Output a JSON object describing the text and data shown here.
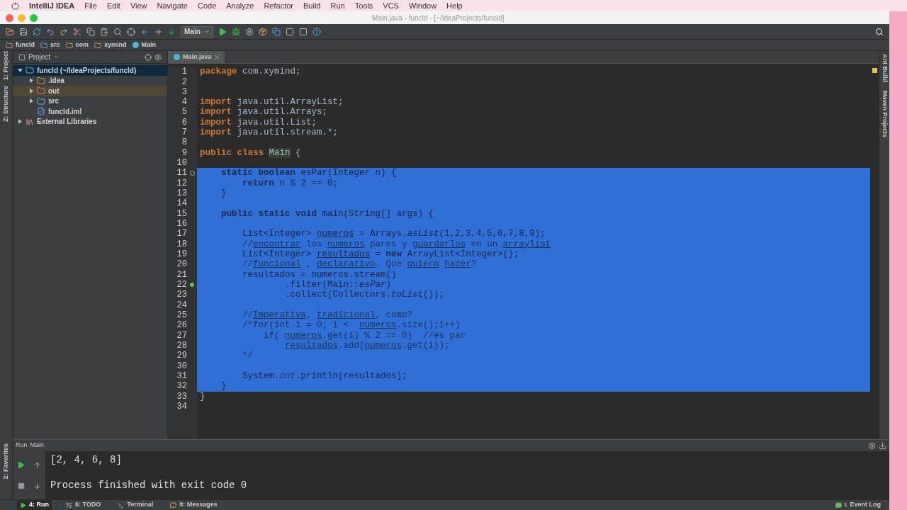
{
  "menu_bar": {
    "app": "IntelliJ IDEA",
    "items": [
      "File",
      "Edit",
      "View",
      "Navigate",
      "Code",
      "Analyze",
      "Refactor",
      "Build",
      "Run",
      "Tools",
      "VCS",
      "Window",
      "Help"
    ]
  },
  "window": {
    "title": "Main.java - funcld - [~/IdeaProjects/funcld]"
  },
  "toolbar": {
    "run_config": "Main"
  },
  "breadcrumbs": [
    {
      "label": "funcld",
      "kind": "folder"
    },
    {
      "label": "src",
      "kind": "source"
    },
    {
      "label": "com",
      "kind": "package"
    },
    {
      "label": "xymind",
      "kind": "package"
    },
    {
      "label": "Main",
      "kind": "class"
    }
  ],
  "left_stripe": [
    "1: Project",
    "Z: Structure",
    "2: Favorites"
  ],
  "right_stripe": [
    "Ant Build",
    "Maven Projects"
  ],
  "project_panel": {
    "title": "Project",
    "tree": [
      {
        "label": "funcld (~/IdeaProjects/funcld)",
        "kind": "module",
        "expanded": true,
        "selected": true,
        "children": [
          {
            "label": ".idea",
            "kind": "folder",
            "expanded": false,
            "selected": false
          },
          {
            "label": "out",
            "kind": "excluded",
            "expanded": false,
            "selected": false,
            "highlighted": true
          },
          {
            "label": "src",
            "kind": "source",
            "expanded": false,
            "selected": false
          },
          {
            "label": "funcld.iml",
            "kind": "file",
            "selected": false
          }
        ]
      },
      {
        "label": "External Libraries",
        "kind": "library",
        "expanded": false,
        "selected": false
      }
    ]
  },
  "editor": {
    "tabs": [
      {
        "label": "Main.java",
        "selected": true
      }
    ],
    "lines": [
      {
        "n": "1",
        "selected": false,
        "tokens": [
          {
            "kind": "kw",
            "t": "package"
          },
          {
            "kind": "txt",
            "t": " com.xymind;"
          }
        ]
      },
      {
        "n": "2",
        "selected": false
      },
      {
        "n": "3",
        "selected": false
      },
      {
        "n": "4",
        "selected": false,
        "tokens": [
          {
            "kind": "kw",
            "t": "import"
          },
          {
            "kind": "txt",
            "t": " java.util.ArrayList;"
          }
        ]
      },
      {
        "n": "5",
        "selected": false,
        "tokens": [
          {
            "kind": "kw",
            "t": "import"
          },
          {
            "kind": "txt",
            "t": " java.util.Arrays;"
          }
        ]
      },
      {
        "n": "6",
        "selected": false,
        "tokens": [
          {
            "kind": "kw",
            "t": "import"
          },
          {
            "kind": "txt",
            "t": " java.util.List;"
          }
        ]
      },
      {
        "n": "7",
        "selected": false,
        "tokens": [
          {
            "kind": "kw",
            "t": "import"
          },
          {
            "kind": "txt",
            "t": " java.util.stream.*;"
          }
        ]
      },
      {
        "n": "8",
        "selected": false
      },
      {
        "n": "9",
        "selected": false,
        "tokens": [
          {
            "kind": "kw",
            "t": "public class "
          },
          {
            "kind": "hl",
            "t": "Main"
          },
          {
            "kind": "txt",
            "t": " {"
          }
        ]
      },
      {
        "n": "10",
        "selected": false
      },
      {
        "n": "11",
        "selected": true,
        "marker": {
          "kind": "override"
        },
        "tokens": [
          {
            "kind": "kw",
            "t": "    static boolean "
          },
          {
            "kind": "fn",
            "t": "esPar"
          },
          {
            "kind": "txt",
            "t": "(Integer n) {"
          }
        ]
      },
      {
        "n": "12",
        "selected": true,
        "tokens": [
          {
            "kind": "kw",
            "t": "        return"
          },
          {
            "kind": "txt",
            "t": " n % "
          },
          {
            "kind": "num",
            "t": "2"
          },
          {
            "kind": "txt",
            "t": " == "
          },
          {
            "kind": "num",
            "t": "0"
          },
          {
            "kind": "txt",
            "t": ";"
          }
        ]
      },
      {
        "n": "13",
        "selected": true,
        "tokens": [
          {
            "kind": "txt",
            "t": "    }"
          }
        ]
      },
      {
        "n": "14",
        "selected": true
      },
      {
        "n": "15",
        "selected": true,
        "tokens": [
          {
            "kind": "kw",
            "t": "    public static void "
          },
          {
            "kind": "fn",
            "t": "main"
          },
          {
            "kind": "txt",
            "t": "(String[] args) {"
          }
        ]
      },
      {
        "n": "16",
        "selected": true
      },
      {
        "n": "17",
        "selected": true,
        "tokens": [
          {
            "kind": "txt",
            "t": "        List<Integer> "
          },
          {
            "kind": "typo",
            "t": "numeros"
          },
          {
            "kind": "txt",
            "t": " = Arrays."
          },
          {
            "kind": "italic",
            "t": "asList"
          },
          {
            "kind": "txt",
            "t": "(1,2,3,4,5,6,7,8,9);"
          }
        ]
      },
      {
        "n": "18",
        "selected": true,
        "tokens": [
          {
            "kind": "cmt",
            "t": "        //"
          },
          {
            "kind": "ctypo",
            "t": "encontrar"
          },
          {
            "kind": "cmt",
            "t": " los "
          },
          {
            "kind": "ctypo",
            "t": "numeros"
          },
          {
            "kind": "cmt",
            "t": " pares y "
          },
          {
            "kind": "ctypo",
            "t": "guardarlos"
          },
          {
            "kind": "cmt",
            "t": " en un "
          },
          {
            "kind": "ctypo",
            "t": "arraylist"
          }
        ]
      },
      {
        "n": "19",
        "selected": true,
        "tokens": [
          {
            "kind": "txt",
            "t": "        List<Integer> "
          },
          {
            "kind": "typo",
            "t": "resultados"
          },
          {
            "kind": "txt",
            "t": " = "
          },
          {
            "kind": "kw",
            "t": "new"
          },
          {
            "kind": "txt",
            "t": " ArrayList<Integer>();"
          }
        ]
      },
      {
        "n": "20",
        "selected": true,
        "tokens": [
          {
            "kind": "cmt",
            "t": "        //"
          },
          {
            "kind": "ctypo",
            "t": "funcional"
          },
          {
            "kind": "cmt",
            "t": " , "
          },
          {
            "kind": "ctypo",
            "t": "declarativo"
          },
          {
            "kind": "cmt",
            "t": ". Que "
          },
          {
            "kind": "ctypo",
            "t": "quiero"
          },
          {
            "kind": "ctypo",
            "t": " hacer"
          },
          {
            "kind": "cmt",
            "t": "?"
          }
        ]
      },
      {
        "n": "21",
        "selected": true,
        "tokens": [
          {
            "kind": "txt",
            "t": "        resultados = numeros.stream()"
          }
        ]
      },
      {
        "n": "22",
        "selected": true,
        "marker": {
          "kind": "lambda"
        },
        "tokens": [
          {
            "kind": "txt",
            "t": "                .filter(Main::"
          },
          {
            "kind": "italic",
            "t": "esPar"
          },
          {
            "kind": "txt",
            "t": ")"
          }
        ]
      },
      {
        "n": "23",
        "selected": true,
        "tokens": [
          {
            "kind": "txt",
            "t": "                .collect(Collectors."
          },
          {
            "kind": "italic",
            "t": "toList"
          },
          {
            "kind": "txt",
            "t": "());"
          }
        ]
      },
      {
        "n": "24",
        "selected": true
      },
      {
        "n": "25",
        "selected": true,
        "tokens": [
          {
            "kind": "cmt",
            "t": "        //"
          },
          {
            "kind": "ctypo",
            "t": "Imperativa"
          },
          {
            "kind": "cmt",
            "t": ", "
          },
          {
            "kind": "ctypo",
            "t": "tradicional"
          },
          {
            "kind": "cmt",
            "t": ", como?"
          }
        ]
      },
      {
        "n": "26",
        "selected": true,
        "tokens": [
          {
            "kind": "cmt",
            "t": "        /*for(int i = 0; i <  "
          },
          {
            "kind": "ctypo",
            "t": "numeros"
          },
          {
            "kind": "cmt",
            "t": ".size();i++)"
          }
        ]
      },
      {
        "n": "27",
        "selected": true,
        "tokens": [
          {
            "kind": "cmt",
            "t": "            if( "
          },
          {
            "kind": "ctypo",
            "t": "numeros"
          },
          {
            "kind": "cmt",
            "t": ".get(i) % 2 == 0)  //es par"
          }
        ]
      },
      {
        "n": "28",
        "selected": true,
        "tokens": [
          {
            "kind": "ctypo",
            "t": "                resultados"
          },
          {
            "kind": "cmt",
            "t": ".add("
          },
          {
            "kind": "ctypo",
            "t": "numeros"
          },
          {
            "kind": "cmt",
            "t": ".get(i));"
          }
        ]
      },
      {
        "n": "29",
        "selected": true,
        "tokens": [
          {
            "kind": "cmt",
            "t": "        */"
          }
        ]
      },
      {
        "n": "30",
        "selected": true
      },
      {
        "n": "31",
        "selected": true,
        "tokens": [
          {
            "kind": "txt",
            "t": "        System."
          },
          {
            "kind": "field",
            "t": "out"
          },
          {
            "kind": "txt",
            "t": ".println(resultados);"
          }
        ]
      },
      {
        "n": "32",
        "selected": true,
        "tokens": [
          {
            "kind": "txt",
            "t": "    }"
          }
        ]
      },
      {
        "n": "33",
        "selected": false,
        "tokens": [
          {
            "kind": "txt",
            "t": "}"
          }
        ]
      },
      {
        "n": "34",
        "selected": false
      }
    ]
  },
  "run_panel": {
    "label": "Run",
    "config": "Main",
    "output": [
      "[2, 4, 6, 8]",
      "Process finished with exit code 0"
    ]
  },
  "bottom_bar": {
    "tools": [
      {
        "label": "4: Run",
        "kind": "run",
        "selected": true
      },
      {
        "label": "6: TODO",
        "kind": "todo",
        "selected": false
      },
      {
        "label": "Terminal",
        "kind": "terminal",
        "selected": false
      },
      {
        "label": "0: Messages",
        "kind": "messages",
        "selected": false
      }
    ],
    "event_log": "Event Log",
    "event_count": "1"
  }
}
